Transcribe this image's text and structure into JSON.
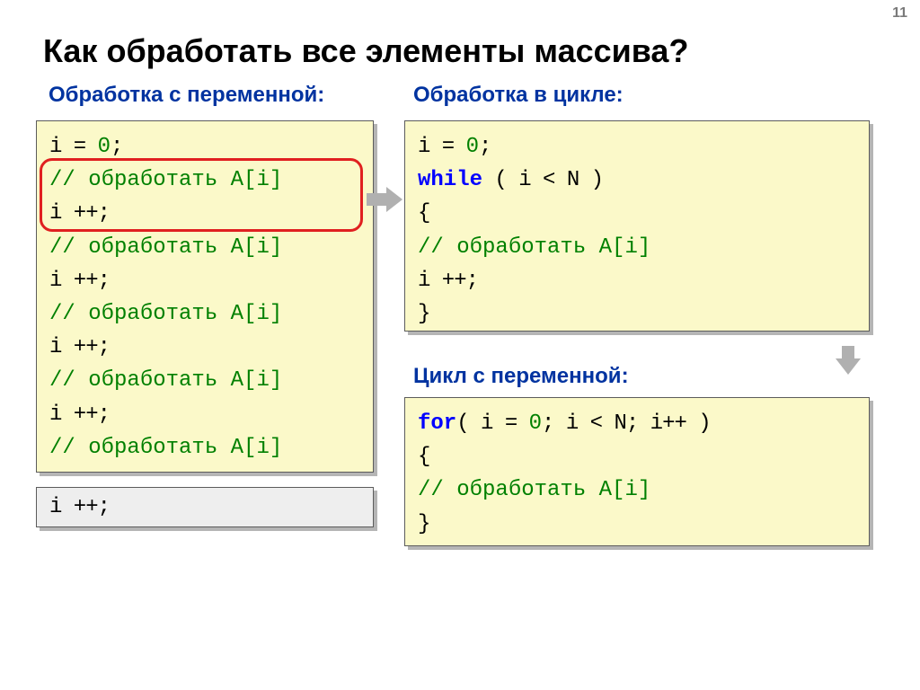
{
  "page_number": "11",
  "title": "Как обработать все элементы массива?",
  "subheads": {
    "left": "Обработка с переменной:",
    "right": "Обработка в цикле:",
    "cycle": "Цикл с переменной:"
  },
  "left_block": {
    "l1a": "i = ",
    "l1b": "0",
    "l1c": ";",
    "c1": "// обработать A[i]",
    "i1": "i ++;",
    "c2": "// обработать A[i]",
    "i2": "i ++;",
    "c3": "// обработать A[i]",
    "i3": "i ++;",
    "c4": "// обработать A[i]",
    "i4": "i ++;",
    "c5": "// обработать A[i]",
    "ext": "i ++;"
  },
  "while_block": {
    "l1a": "i = ",
    "l1b": "0",
    "l1c": ";",
    "kw": "while",
    "cond": " ( i < N )",
    "ob": "  {",
    "body_c": "  // обработать A[i]",
    "body_i": "  i ++;",
    "cb": "  }"
  },
  "for_block": {
    "kw": "for",
    "hdr": "( i = ",
    "z": "0",
    "rest": "; i < N; i++ )",
    "ob": "  {",
    "body_c": "  // обработать A[i]",
    "cb": "  }"
  }
}
